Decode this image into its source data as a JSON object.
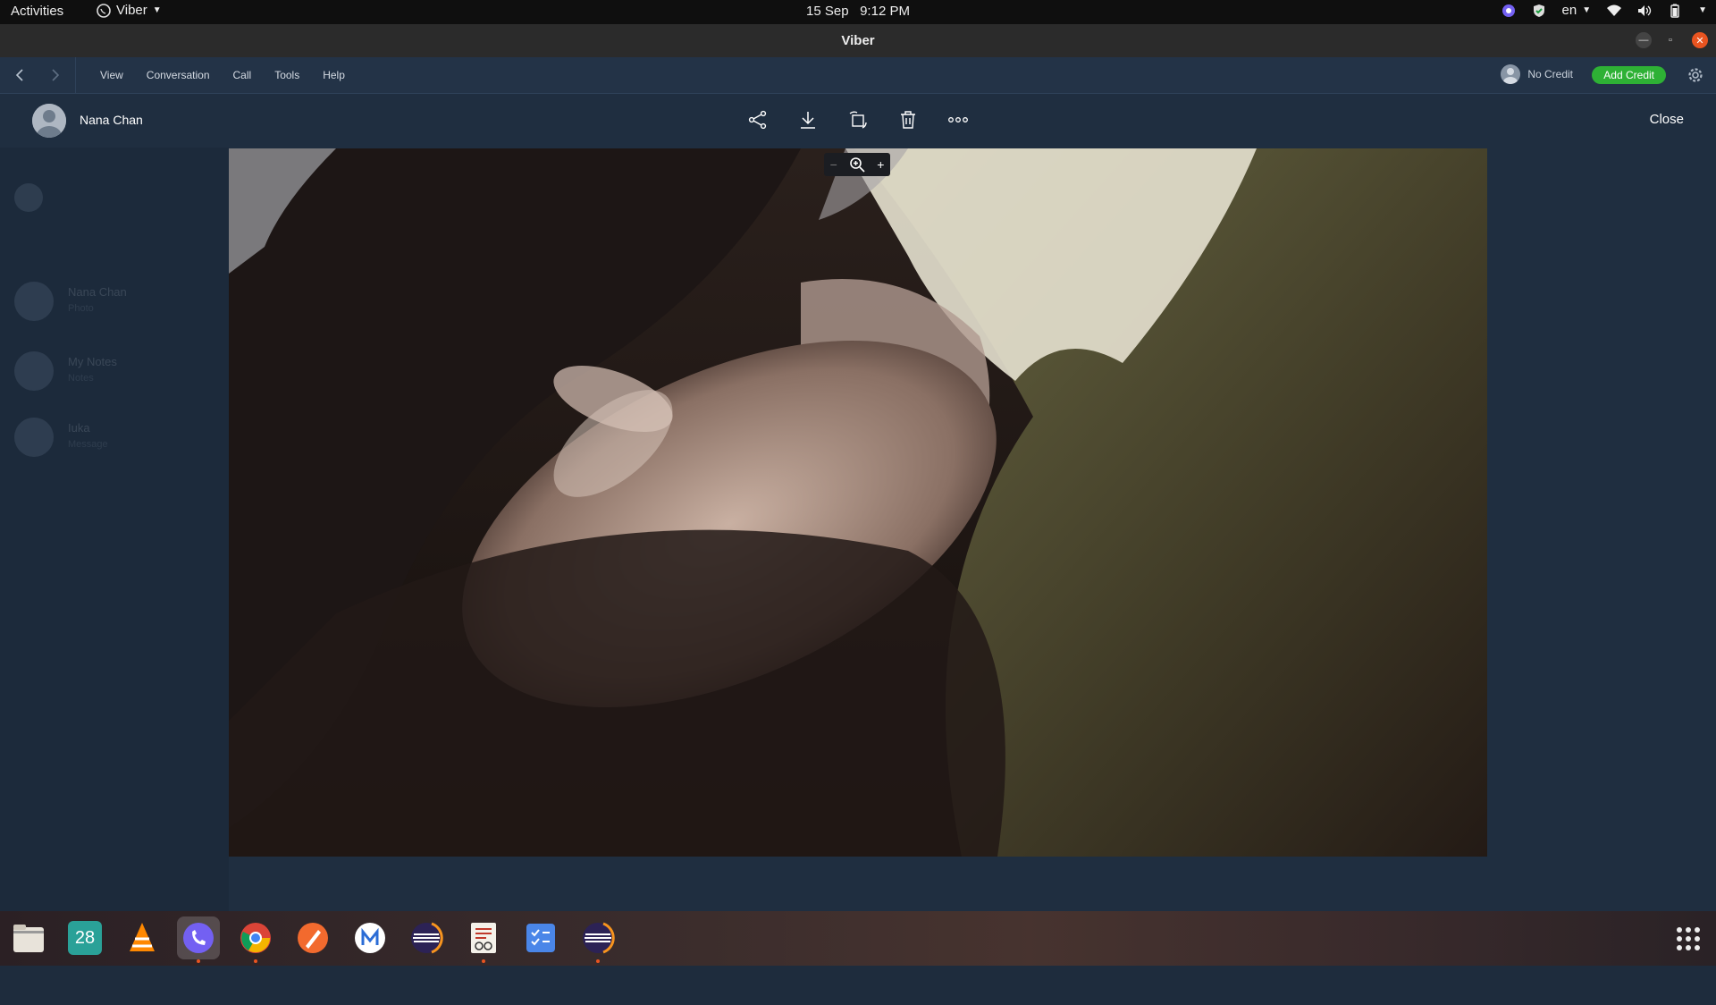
{
  "topbar": {
    "activities": "Activities",
    "app_menu": "Viber",
    "date": "15 Sep",
    "time": "9:12 PM",
    "keyboard_layout": "en"
  },
  "window": {
    "title": "Viber"
  },
  "menubar": {
    "items": [
      "View",
      "Conversation",
      "Call",
      "Tools",
      "Help"
    ],
    "credit_label": "No Credit",
    "add_credit_label": "Add Credit"
  },
  "viewer": {
    "contact_name": "Nana Chan",
    "close_label": "Close",
    "actions": [
      "share-icon",
      "download-icon",
      "rotate-icon",
      "trash-icon",
      "more-icon"
    ],
    "zoom_out": "−",
    "zoom_in": "+"
  },
  "sidebar": {
    "chats": [
      {
        "name": "Nana Chan",
        "preview": "Photo"
      },
      {
        "name": "My Notes",
        "preview": "Notes"
      },
      {
        "name": "Iuka",
        "preview": "Message"
      }
    ]
  },
  "dock": {
    "calendar_day": "28",
    "apps": [
      "files",
      "calendar",
      "vlc",
      "viber",
      "chrome",
      "draw",
      "markdown",
      "eclipse",
      "document-viewer",
      "tasks",
      "eclipse-2"
    ]
  },
  "colors": {
    "accent_green": "#2eb135",
    "close_orange": "#e95420",
    "viber_purple": "#7360f2"
  }
}
